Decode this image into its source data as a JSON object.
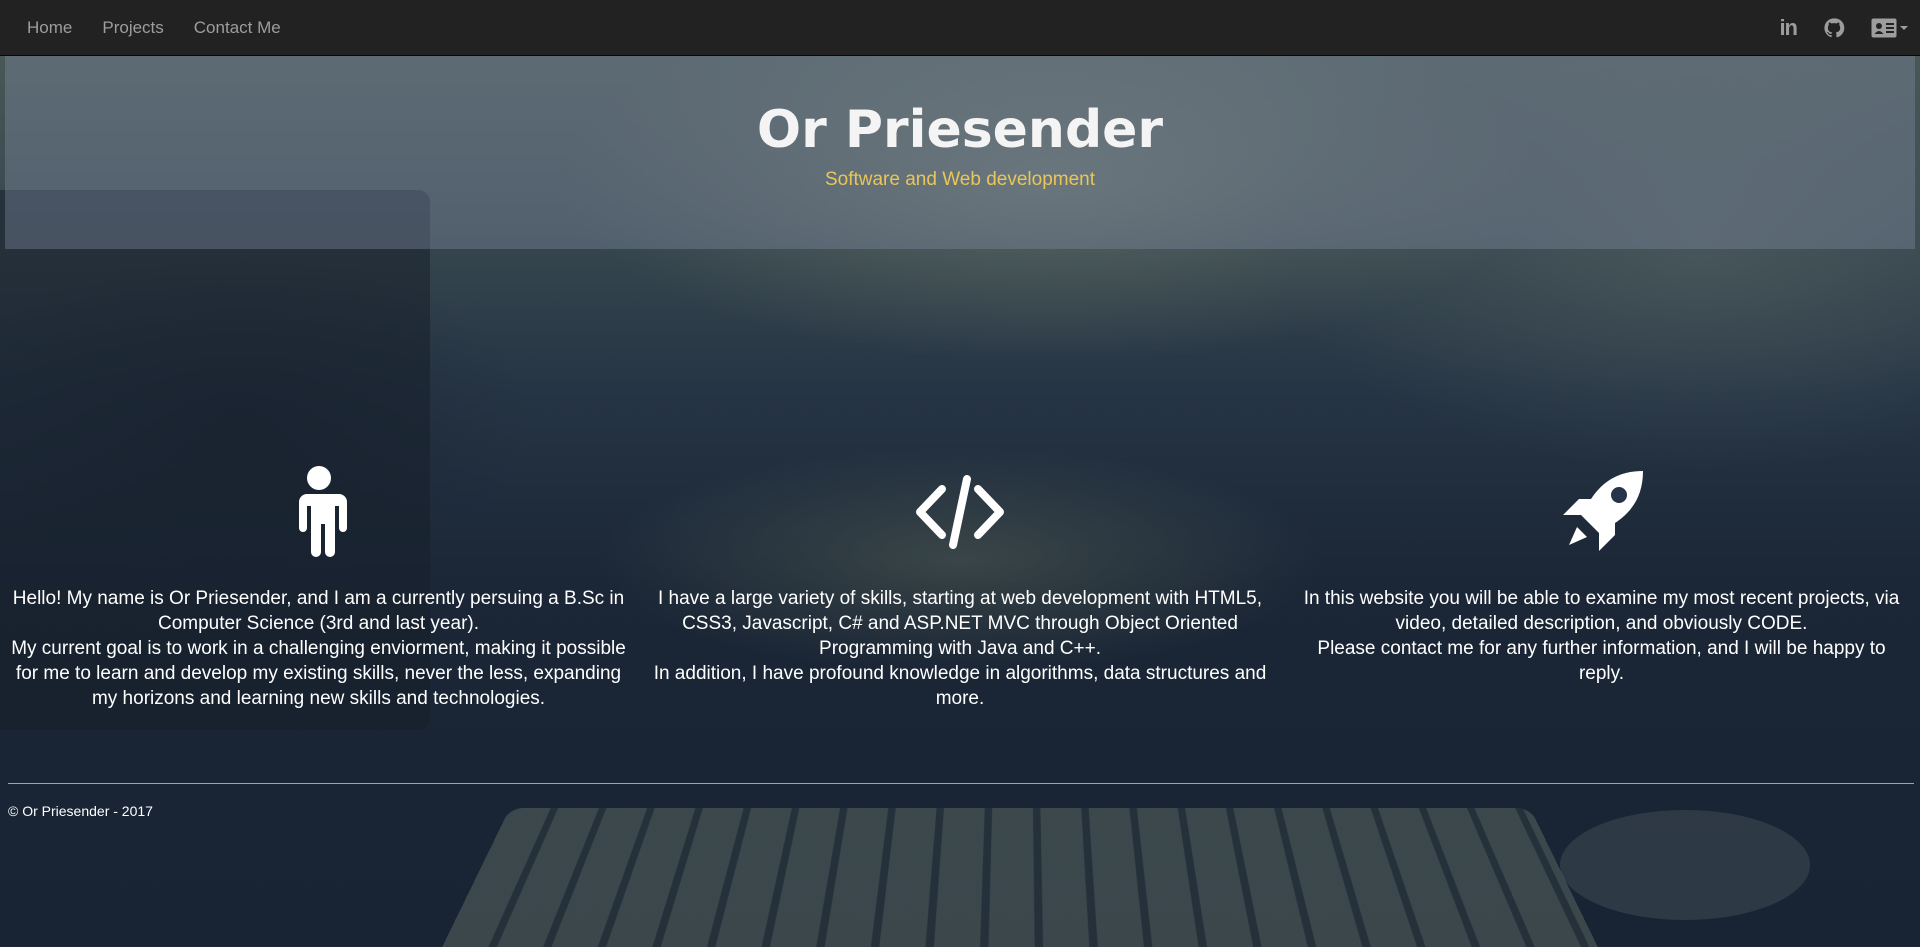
{
  "nav": {
    "links": [
      "Home",
      "Projects",
      "Contact Me"
    ],
    "right_icons": [
      "linkedin-icon",
      "github-icon",
      "contact-card-icon"
    ],
    "linkedin_label": "in"
  },
  "header": {
    "title": "Or Priesender",
    "subtitle": "Software and Web development"
  },
  "features": [
    {
      "icon": "person-icon",
      "lines": [
        "Hello! My name is Or Priesender, and I am a currently persuing a B.Sc in Computer Science (3rd and last year).",
        "My current goal is to work in a challenging enviorment, making it possible for me to learn and develop my existing skills, never the less, expanding my horizons and learning new skills and technologies."
      ]
    },
    {
      "icon": "code-icon",
      "lines": [
        "I have a large variety of skills, starting at web development with HTML5, CSS3, Javascript, C# and ASP.NET MVC through Object Oriented Programming with Java and C++.",
        "In addition, I have profound knowledge in algorithms, data structures and more."
      ]
    },
    {
      "icon": "rocket-icon",
      "lines": [
        "In this website you will be able to examine my most recent projects, via video, detailed description, and obviously CODE.",
        "Please contact me for any further information, and I will be happy to reply."
      ]
    }
  ],
  "footer": {
    "copyright": "© Or Priesender - 2017"
  },
  "colors": {
    "navbar_bg": "#222222",
    "nav_text": "#9d9d9d",
    "subtitle": "#e8c65a",
    "text": "#ffffff"
  }
}
